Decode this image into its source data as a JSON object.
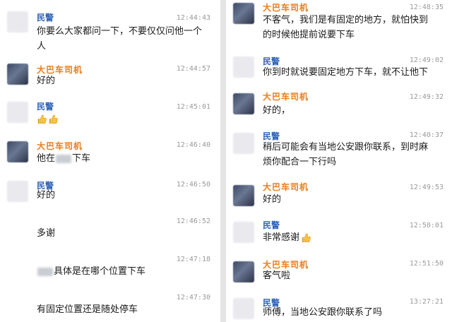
{
  "colors": {
    "police_name": "#2f63b8",
    "driver_name": "#e8862a",
    "timestamp": "#9a9a9a",
    "background": "#ffffff"
  },
  "icons": {
    "thumbs_up": "thumbs-up-icon"
  },
  "left": {
    "messages": [
      {
        "sender": "民警",
        "time": "12:44:43",
        "line1": "你要么大家都问一下，不要仅仅问他一个",
        "line2": "人"
      },
      {
        "sender": "大巴车司机",
        "time": "12:44:57",
        "text": "好的"
      },
      {
        "sender": "民警",
        "time": "12:45:01"
      },
      {
        "sender": "大巴车司机",
        "time": "12:46:40",
        "text_before": "他在",
        "text_after": "下车"
      },
      {
        "sender": "民警",
        "time": "12:46:50",
        "text": "好的"
      },
      {
        "time": "12:46:52",
        "text": "多谢"
      },
      {
        "time": "12:47:18",
        "text": "具体是在哪个位置下车"
      },
      {
        "time": "12:47:30",
        "text": "有固定位置还是随处停车"
      }
    ]
  },
  "right": {
    "messages": [
      {
        "sender": "大巴车司机",
        "time": "12:48:35",
        "line1": "不客气，我们是有固定的地方，就怕快到",
        "line2": "的时候他提前说要下车"
      },
      {
        "sender": "民警",
        "time": "12:49:02",
        "text": "你到时就说要固定地方下车，就不让他下"
      },
      {
        "sender": "大巴车司机",
        "time": "12:49:32",
        "text": "好的，"
      },
      {
        "sender": "民警",
        "time": "12:40:37",
        "line1": "稍后可能会有当地公安跟你联系，到时麻",
        "line2": "烦你配合一下行吗"
      },
      {
        "sender": "大巴车司机",
        "time": "12:49:53",
        "text": "好的"
      },
      {
        "sender": "民警",
        "time": "12:50:01",
        "text": "非常感谢"
      },
      {
        "sender": "大巴车司机",
        "time": "12:51:50",
        "text": "客气啦"
      },
      {
        "sender": "民警",
        "time": "13:27:21",
        "text": "师傅，当地公安跟你联系了吗"
      }
    ]
  }
}
